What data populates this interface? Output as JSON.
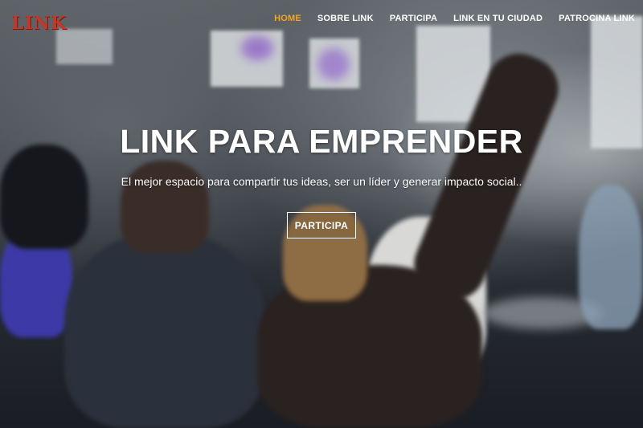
{
  "brand": {
    "logo_text": "LINK"
  },
  "nav": {
    "items": [
      {
        "label": "HOME",
        "active": true
      },
      {
        "label": "SOBRE LINK",
        "active": false
      },
      {
        "label": "PARTICIPA",
        "active": false
      },
      {
        "label": "LINK EN TU CIUDAD",
        "active": false
      },
      {
        "label": "PATROCINA LINK",
        "active": false
      }
    ],
    "active_color": "#f0a527"
  },
  "hero": {
    "title": "LINK PARA EMPRENDER",
    "subtitle": "El mejor espacio para compartir tus ideas, ser un líder y generar impacto social..",
    "cta_label": "PARTICIPA"
  },
  "colors": {
    "logo": "#c0392b",
    "text": "#ffffff"
  }
}
